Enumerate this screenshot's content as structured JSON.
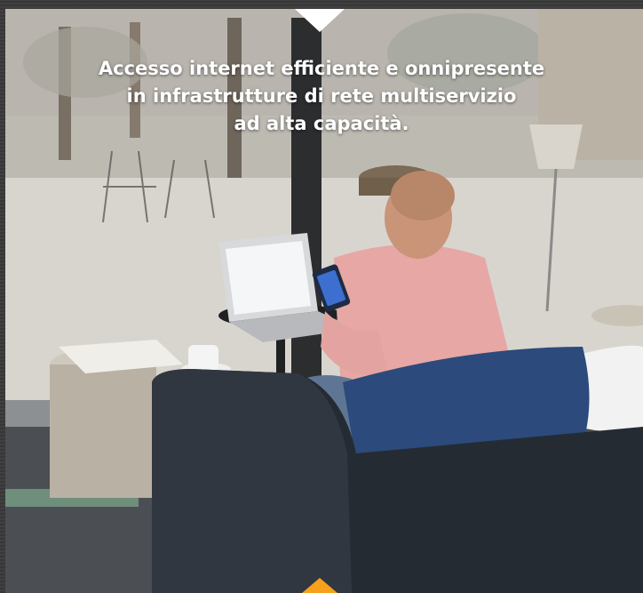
{
  "hero": {
    "headline_lines": [
      "Accesso internet efficiente e onnipresente",
      "in infrastrutture di rete multiservizio",
      "ad alta capacità."
    ],
    "photo_icon": "cafe-photo",
    "accent_color": "#f5a11c",
    "notch_color": "#ffffff"
  }
}
